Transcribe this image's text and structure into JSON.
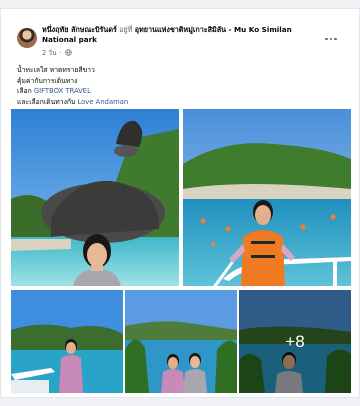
{
  "post": {
    "author": "หนึ่งฤทัย ลักษณะบิรันดร์",
    "at_word": "อยู่ที่",
    "location_line1": "อุทยานแห่งชาติหมู่เกาะสิมิลัน - Mu Ko Similan",
    "location_line2": "National park",
    "time": "2 วัน",
    "caption": {
      "line1": "น้ำทะเลใส หาดทรายสีขาว",
      "line2": "คุ้มค่ากับการเดินทาง",
      "line3_prefix": "เลือก",
      "line3_link": "GIFTBOX TRAVEL",
      "line4_prefix": "และเลือกเดินทางกับ",
      "line4_link": "Love Andaman"
    },
    "more_photos_label": "+8"
  },
  "icons": {
    "privacy": "globe-icon",
    "options": "more-horizontal-icon"
  },
  "colors": {
    "link": "#385898",
    "secondary_text": "#65676b",
    "card_bg": "#ffffff"
  }
}
